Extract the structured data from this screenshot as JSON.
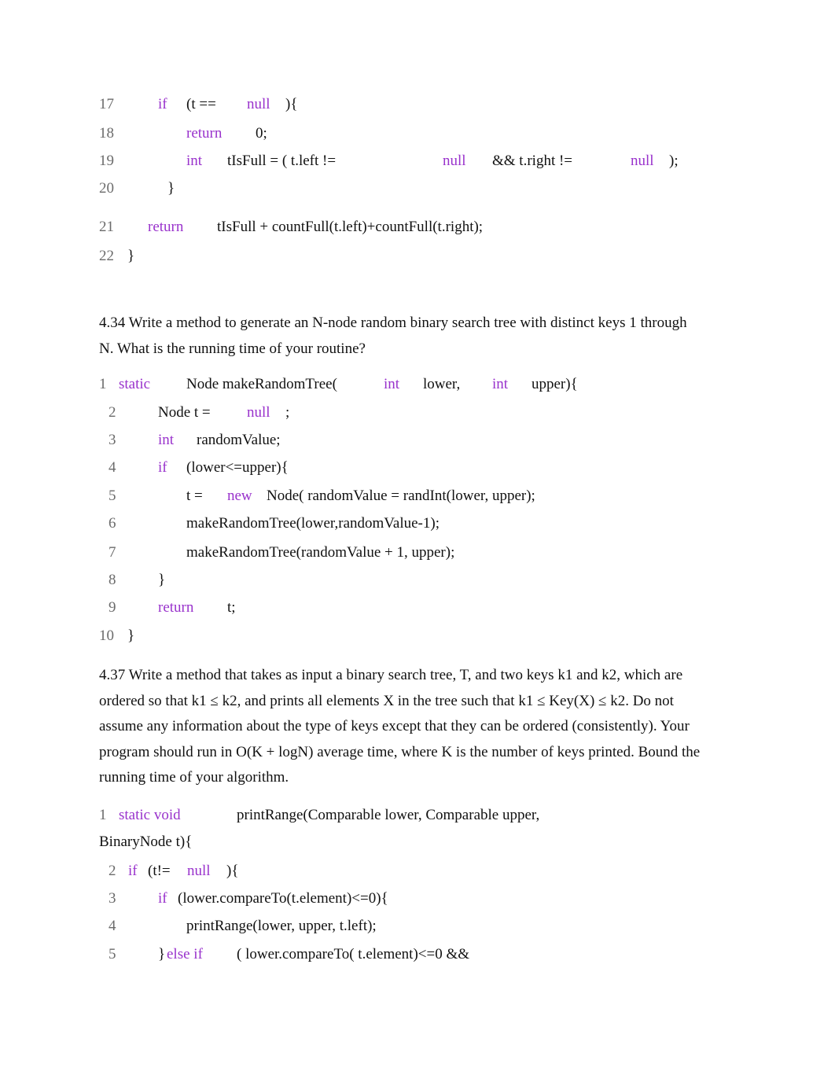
{
  "colors": {
    "keyword": "#9932cc",
    "line_number": "#6b6b6b",
    "text": "#111111",
    "background": "#ffffff"
  },
  "block1": {
    "lines": [
      {
        "num": "17",
        "tokens": [
          {
            "t": "if",
            "k": 1
          },
          {
            "t": "(t ==",
            "k": 0
          },
          {
            "t": "null",
            "k": 1
          },
          {
            "t": "){",
            "k": 0
          }
        ]
      },
      {
        "num": "18",
        "tokens": [
          {
            "t": "return",
            "k": 1
          },
          {
            "t": "0;",
            "k": 0
          }
        ]
      },
      {
        "num": "19",
        "tokens": [
          {
            "t": "int",
            "k": 1
          },
          {
            "t": "tIsFull = ( t.left !=",
            "k": 0
          },
          {
            "t": "null",
            "k": 1
          },
          {
            "t": "&& t.right !=",
            "k": 0
          },
          {
            "t": "null",
            "k": 1
          },
          {
            "t": ");",
            "k": 0
          }
        ]
      },
      {
        "num": "20",
        "tokens": [
          {
            "t": "}",
            "k": 0
          }
        ]
      },
      {
        "num": "21",
        "tokens": [
          {
            "t": "return",
            "k": 1
          },
          {
            "t": "tIsFull + countFull(t.left)+countFull(t.right);",
            "k": 0
          }
        ]
      },
      {
        "num": "22",
        "tokens": [
          {
            "t": "}",
            "k": 0
          }
        ]
      }
    ]
  },
  "q434": {
    "text": "4.34 Write a method to generate an N-node random binary search tree with distinct keys 1 through N. What is the running time of your routine?"
  },
  "block2": {
    "lines": [
      {
        "num": "1",
        "tokens": [
          {
            "t": "static",
            "k": 1
          },
          {
            "t": "Node makeRandomTree(",
            "k": 0
          },
          {
            "t": "int",
            "k": 1
          },
          {
            "t": "lower,",
            "k": 0
          },
          {
            "t": "int",
            "k": 1
          },
          {
            "t": "upper){",
            "k": 0
          }
        ]
      },
      {
        "num": "2",
        "tokens": [
          {
            "t": "Node t =",
            "k": 0
          },
          {
            "t": "null",
            "k": 1
          },
          {
            "t": ";",
            "k": 0
          }
        ]
      },
      {
        "num": "3",
        "tokens": [
          {
            "t": "int",
            "k": 1
          },
          {
            "t": "randomValue;",
            "k": 0
          }
        ]
      },
      {
        "num": "4",
        "tokens": [
          {
            "t": "if",
            "k": 1
          },
          {
            "t": "(lower<=upper){",
            "k": 0
          }
        ]
      },
      {
        "num": "5",
        "tokens": [
          {
            "t": "t =",
            "k": 0
          },
          {
            "t": "new",
            "k": 1
          },
          {
            "t": "Node( randomValue = randInt(lower, upper);",
            "k": 0
          }
        ]
      },
      {
        "num": "6",
        "tokens": [
          {
            "t": "makeRandomTree(lower,randomValue-1);",
            "k": 0
          }
        ]
      },
      {
        "num": "7",
        "tokens": [
          {
            "t": "makeRandomTree(randomValue + 1, upper);",
            "k": 0
          }
        ]
      },
      {
        "num": "8",
        "tokens": [
          {
            "t": "}",
            "k": 0
          }
        ]
      },
      {
        "num": "9",
        "tokens": [
          {
            "t": "return",
            "k": 1
          },
          {
            "t": "t;",
            "k": 0
          }
        ]
      },
      {
        "num": "10",
        "tokens": [
          {
            "t": "}",
            "k": 0
          }
        ]
      }
    ]
  },
  "q437": {
    "text": "4.37 Write a method that takes as input a binary search tree, T, and two keys k1 and k2, which are ordered so that k1 ≤ k2, and prints all elements X in the tree such that k1 ≤ Key(X) ≤ k2. Do not assume any information about the type of keys except that they can be ordered (consistently). Your program should run in O(K + logN) average time, where K is the number of keys printed. Bound the running time of your algorithm."
  },
  "block3": {
    "lines": [
      {
        "num": "1",
        "tokens": [
          {
            "t": "static void",
            "k": 1
          },
          {
            "t": "printRange(Comparable lower, Comparable upper,",
            "k": 0
          }
        ]
      },
      {
        "num": "",
        "tokens": [
          {
            "t": "BinaryNode t){",
            "k": 0
          }
        ]
      },
      {
        "num": "2",
        "tokens": [
          {
            "t": "if",
            "k": 1
          },
          {
            "t": "(t!=",
            "k": 0
          },
          {
            "t": "null",
            "k": 1
          },
          {
            "t": "){",
            "k": 0
          }
        ]
      },
      {
        "num": "3",
        "tokens": [
          {
            "t": "if",
            "k": 1
          },
          {
            "t": "(lower.compareTo(t.element)<=0){",
            "k": 0
          }
        ]
      },
      {
        "num": "4",
        "tokens": [
          {
            "t": "printRange(lower, upper, t.left);",
            "k": 0
          }
        ]
      },
      {
        "num": "5",
        "tokens": [
          {
            "t": "}",
            "k": 0
          },
          {
            "t": "else if",
            "k": 1
          },
          {
            "t": "( lower.compareTo( t.element)<=0 &&",
            "k": 0
          }
        ]
      }
    ]
  }
}
